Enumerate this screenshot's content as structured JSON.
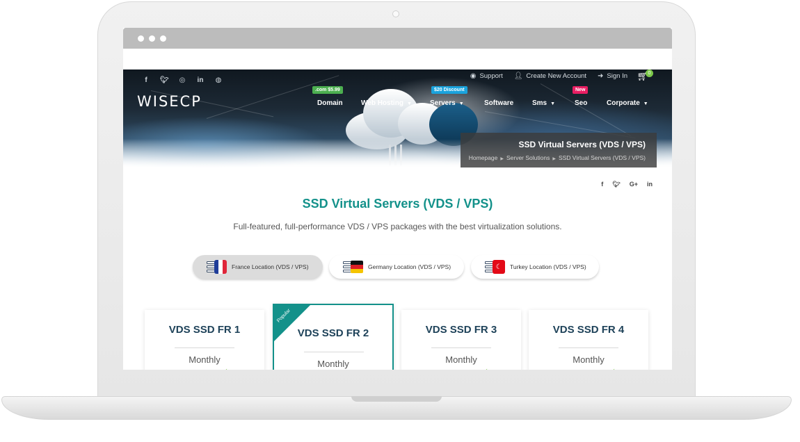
{
  "site": {
    "logo": "WISECP",
    "social_top": [
      "f",
      "t",
      "ig",
      "in",
      "globe"
    ],
    "top_links": [
      {
        "label": "Support",
        "icon": "support-icon"
      },
      {
        "label": "Create New Account",
        "icon": "user-plus-icon"
      },
      {
        "label": "Sign In",
        "icon": "sign-in-icon"
      }
    ],
    "cart": {
      "icon": "cart-icon",
      "count": "0"
    },
    "nav": [
      {
        "label": "Domain",
        "badge": ".com $5.99",
        "badge_color": "#4caf50",
        "has_caret": false
      },
      {
        "label": "Web Hosting",
        "badge": "",
        "has_caret": true
      },
      {
        "label": "Servers",
        "badge": "$20 Discount",
        "badge_color": "#1aa3dd",
        "has_caret": true
      },
      {
        "label": "Software",
        "badge": "",
        "has_caret": false
      },
      {
        "label": "Sms",
        "badge": "",
        "has_caret": true
      },
      {
        "label": "Seo",
        "badge": "New",
        "badge_color": "#e91e63",
        "has_caret": false
      },
      {
        "label": "Corporate",
        "badge": "",
        "has_caret": true
      }
    ]
  },
  "page_header": {
    "title": "SSD Virtual Servers (VDS / VPS)",
    "breadcrumb": [
      "Homepage",
      "Server Solutions",
      "SSD Virtual Servers (VDS / VPS)"
    ]
  },
  "share": [
    "f",
    "t",
    "G+",
    "in"
  ],
  "main": {
    "title": "SSD Virtual Servers (VDS / VPS)",
    "subtitle": "Full-featured, full-performance VDS / VPS packages with the best virtualization solutions.",
    "locations": [
      {
        "label": "France Location (VDS / VPS)",
        "active": true,
        "flag": "france"
      },
      {
        "label": "Germany Location (VDS / VPS)",
        "active": false,
        "flag": "germany"
      },
      {
        "label": "Turkey Location (VDS / VPS)",
        "active": false,
        "flag": "turkey"
      }
    ],
    "plans": [
      {
        "name": "VDS SSD FR 1",
        "period": "Monthly",
        "popular": false
      },
      {
        "name": "VDS SSD FR 2",
        "period": "Monthly",
        "popular": true,
        "ribbon": "Popular"
      },
      {
        "name": "VDS SSD FR 3",
        "period": "Monthly",
        "popular": false
      },
      {
        "name": "VDS SSD FR 4",
        "period": "Monthly",
        "popular": false
      }
    ]
  },
  "colors": {
    "accent": "#13918a",
    "heading": "#1e4259",
    "green": "#7cc84a"
  }
}
